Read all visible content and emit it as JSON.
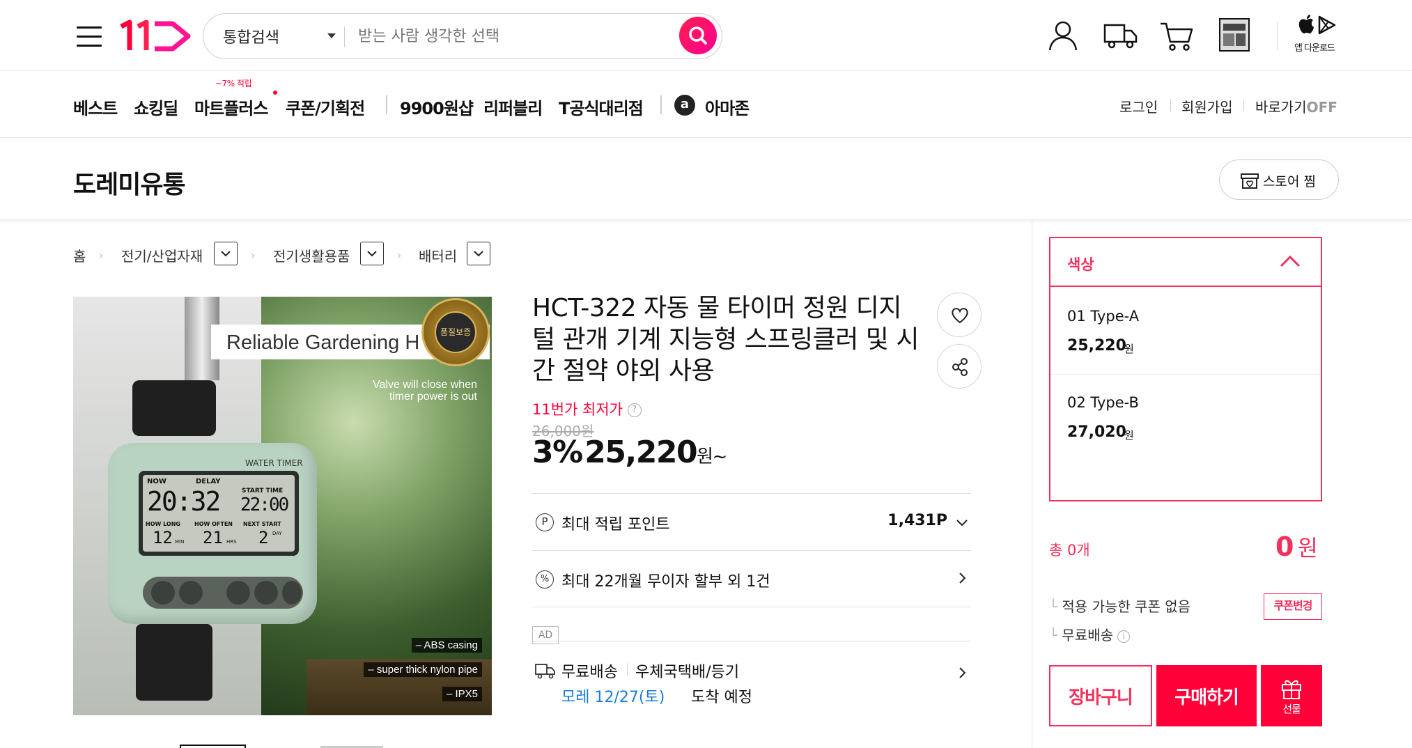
{
  "header": {
    "search_scope": "통합검색",
    "search_placeholder": "받는 사람 생각한 선택",
    "app_download": "앱 다운로드",
    "brand_color": "#ff0038"
  },
  "nav": {
    "items": [
      "베스트",
      "쇼킹딜",
      "마트플러스",
      "쿠폰/기획전",
      "9900원샵",
      "리퍼블리",
      "T공식대리점",
      "아마존"
    ],
    "mart_badge": "~7% 적립",
    "amazon_letter": "a",
    "login": "로그인",
    "signup": "회원가입",
    "shortcut": "바로가기",
    "shortcut_state": "OFF"
  },
  "store": {
    "name": "도레미유통",
    "zzim_label": "스토어 찜"
  },
  "breadcrumb": [
    "홈",
    "전기/산업자재",
    "전기생활용품",
    "배터리"
  ],
  "product_image": {
    "headline": "Reliable Gardening H",
    "valve_note_1": "Valve will close when",
    "valve_note_2": "timer power is out",
    "device_label": "WATER TIMER",
    "now_label": "NOW",
    "delay_label": "DELAY",
    "time": "20:32",
    "start_time_label": "START TIME",
    "start_time": "22:00",
    "how_long_label": "HOW LONG",
    "how_long": "12",
    "how_long_unit": "MIN",
    "how_often_label": "HOW OFTEN",
    "how_often": "21",
    "how_often_unit": "HRS",
    "next_start_label": "NEXT START",
    "next_start": "2",
    "next_start_unit": "DAY",
    "feature_1": "– ABS casing",
    "feature_2": "– super thick nylon pipe",
    "feature_3": "– IPX5",
    "seal_text": "품질보증"
  },
  "product": {
    "title": "HCT-322 자동 물 타이머 정원 디지털 관개 기계 지능형 스프링클러 및 시간 절약 야외 사용",
    "lowest_label": "11번가 최저가",
    "original_price": "26,000원",
    "discount": "3%",
    "price": "25,220",
    "price_unit": "원~",
    "points_label": "최대 적립 포인트",
    "points_value": "1,431P",
    "installment": "최대 22개월 무이자 할부 외 1건",
    "ad_label": "AD",
    "shipping_free": "무료배송",
    "shipping_method": "우체국택배/등기",
    "delivery_date": "모레 12/27(토)",
    "delivery_suffix": "도착 예정"
  },
  "options": {
    "header": "색상",
    "items": [
      {
        "name": "01 Type-A",
        "price": "25,220",
        "unit": "원"
      },
      {
        "name": "02 Type-B",
        "price": "27,020",
        "unit": "원"
      }
    ]
  },
  "summary": {
    "total_count": "총 0개",
    "total_price": "0",
    "total_unit": "원",
    "coupon_text": "적용 가능한 쿠폰 없음",
    "coupon_button": "쿠폰변경",
    "free_shipping": "무료배송"
  },
  "actions": {
    "cart": "장바구니",
    "buy": "구매하기",
    "gift": "선물"
  }
}
